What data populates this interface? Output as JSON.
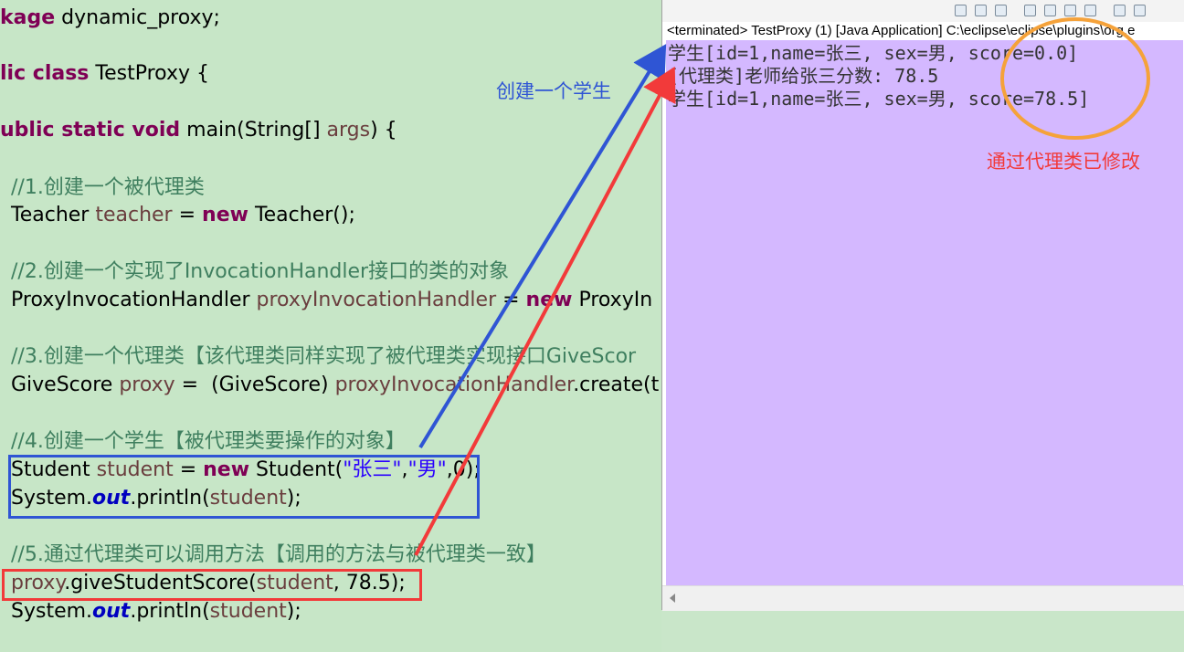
{
  "editor": {
    "lines": {
      "package": [
        "kage",
        " dynamic_proxy;"
      ],
      "class_decl": [
        "lic class",
        " TestProxy {"
      ],
      "main_decl": [
        "ublic static void",
        " main(String[] ",
        "args",
        ") {"
      ],
      "c1": "//1.创建一个被代理类",
      "l1": [
        "Teacher ",
        "teacher",
        " = ",
        "new",
        " Teacher();"
      ],
      "c2": "//2.创建一个实现了InvocationHandler接口的类的对象",
      "l2": [
        "ProxyInvocationHandler ",
        "proxyInvocationHandler",
        " = ",
        "new",
        " ProxyIn"
      ],
      "c3": "//3.创建一个代理类【该代理类同样实现了被代理类实现接口GiveScor",
      "l3": [
        "GiveScore ",
        "proxy",
        " =  (GiveScore) ",
        "proxyInvocationHandler",
        ".create(t"
      ],
      "c4": "//4.创建一个学生【被代理类要操作的对象】",
      "l4": [
        "Student ",
        "student",
        " = ",
        "new",
        " Student(",
        "\"张三\"",
        ",",
        "\"男\"",
        ",0);"
      ],
      "l5": [
        "System.",
        "out",
        ".println(",
        "student",
        ");"
      ],
      "c5": "//5.通过代理类可以调用方法【调用的方法与被代理类一致】",
      "l6": [
        "proxy",
        ".giveStudentScore(",
        "student",
        ", 78.5);"
      ],
      "l7": [
        "System.",
        "out",
        ".println(",
        "student",
        ");"
      ]
    }
  },
  "console": {
    "status": "<terminated> TestProxy (1) [Java Application] C:\\eclipse\\eclipse\\plugins\\org.e",
    "output": [
      "学生[id=1,name=张三, sex=男, score=0.0]",
      "[代理类]老师给张三分数: 78.5",
      "学生[id=1,name=张三, sex=男, score=78.5]"
    ],
    "toolbar_icons": [
      "remove-launch-icon",
      "remove-all-icon",
      "terminate-all-icon",
      "word-wrap-icon",
      "scroll-lock-icon",
      "show-on-out-icon",
      "show-on-err-icon",
      "pin-console-icon",
      "display-console-icon"
    ]
  },
  "annotations": {
    "create_student": "创建一个学生",
    "modified_by_proxy": "通过代理类已修改",
    "colors": {
      "blue": "#2f55d4",
      "red": "#f23a3a",
      "orange": "#f5a23a"
    }
  }
}
